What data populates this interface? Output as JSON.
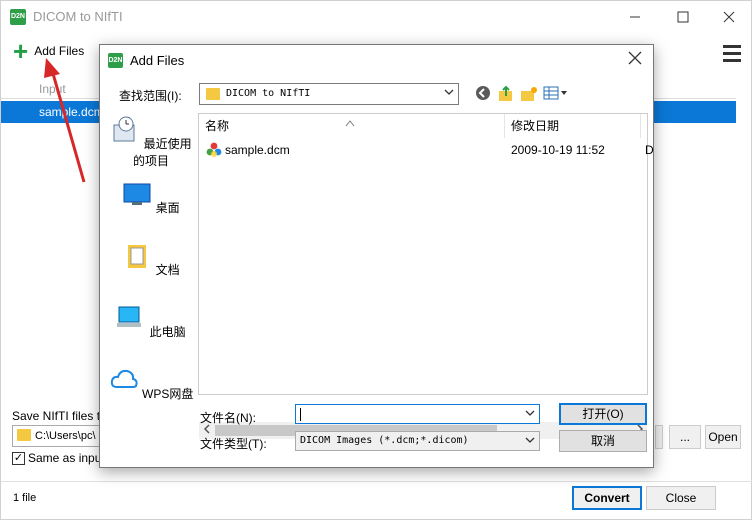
{
  "app": {
    "logo_text": "D2N",
    "title": "DICOM to NIfTI",
    "add_files_label": "Add Files",
    "table": {
      "header_input": "Input",
      "rows": [
        {
          "input": "sample.dcm"
        }
      ]
    },
    "save_label": "Save NIfTI files to",
    "output_path": "C:\\Users\\pc\\",
    "same_as_input_label": "Same as input",
    "same_as_input_checked_glyph": "✓",
    "browse_label": "...",
    "open_label": "Open",
    "file_count": "1 file",
    "convert_label": "Convert",
    "close_label": "Close"
  },
  "dialog": {
    "logo_text": "D2N",
    "title": "Add Files",
    "look_in_label": "查找范围(I):",
    "look_in_value": "DICOM to NIfTI",
    "places": [
      {
        "label": "最近使用的项目",
        "icon": "recent-icon"
      },
      {
        "label": "桌面",
        "icon": "desktop-icon"
      },
      {
        "label": "文档",
        "icon": "documents-icon"
      },
      {
        "label": "此电脑",
        "icon": "this-pc-icon"
      },
      {
        "label": "WPS网盘",
        "icon": "cloud-icon"
      }
    ],
    "columns": {
      "name": "名称",
      "modified": "修改日期"
    },
    "files": [
      {
        "name": "sample.dcm",
        "modified": "2009-10-19 11:52",
        "extra": "D"
      }
    ],
    "file_name_label": "文件名(N):",
    "file_name_value": "",
    "file_type_label": "文件类型(T):",
    "file_type_value": "DICOM Images (*.dcm;*.dicom)",
    "open_label": "打开(O)",
    "cancel_label": "取消"
  },
  "colors": {
    "accent": "#0b78d7",
    "brand": "#2e9e49",
    "annotation": "#d62828"
  }
}
